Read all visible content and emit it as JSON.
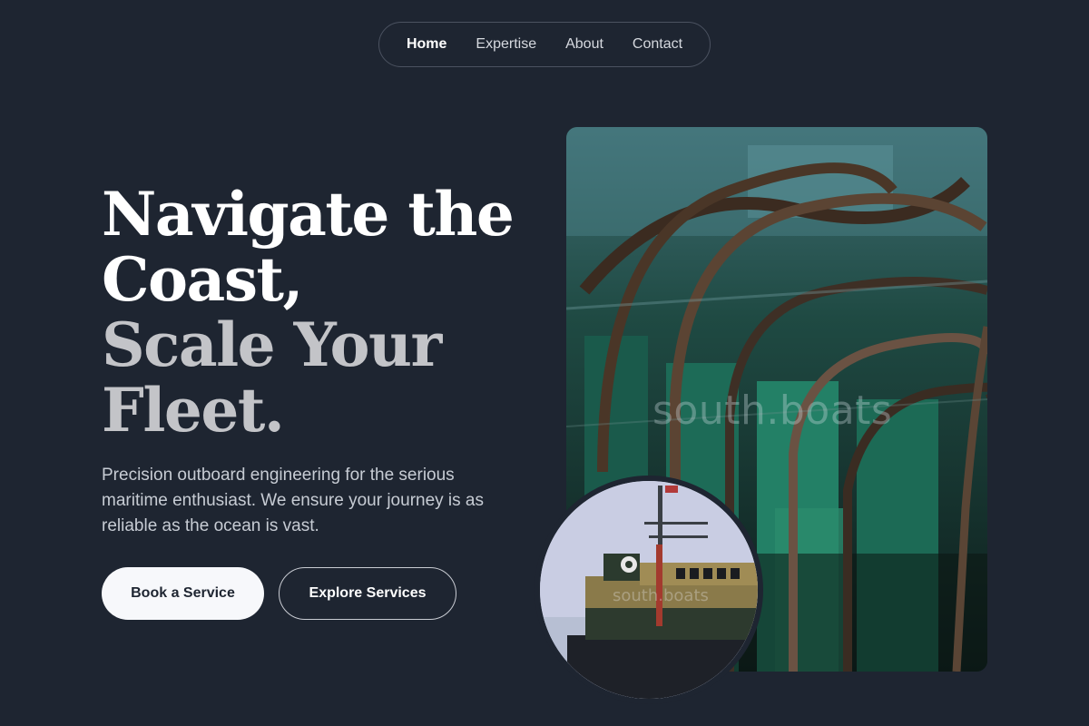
{
  "nav": {
    "items": [
      {
        "label": "Home",
        "active": true
      },
      {
        "label": "Expertise",
        "active": false
      },
      {
        "label": "About",
        "active": false
      },
      {
        "label": "Contact",
        "active": false
      }
    ]
  },
  "hero": {
    "title_line1": "Navigate the Coast,",
    "title_line2": "Scale Your Fleet.",
    "description": "Precision outboard engineering for the serious maritime enthusiast. We ensure your journey is as reliable as the ocean is vast.",
    "primary_button": "Book a Service",
    "secondary_button": "Explore Services"
  },
  "images": {
    "main_watermark": "south.boats",
    "circle_watermark": "south.boats"
  },
  "colors": {
    "background": "#1e2531",
    "primary_button_bg": "#f7f8fb",
    "title_primary": "#ffffff",
    "title_secondary": "#c3c4c8"
  }
}
